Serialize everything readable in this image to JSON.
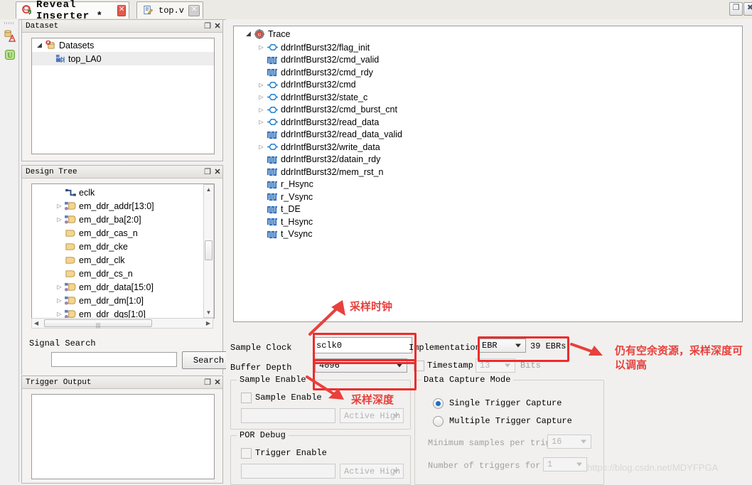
{
  "window": {
    "tabs": [
      {
        "label": "Reveal Inserter *",
        "icon": "reveal-icon",
        "closable": true,
        "active": true
      },
      {
        "label": "top.v",
        "icon": "file-edit-icon",
        "closable": true,
        "active": false
      }
    ],
    "controls": {
      "restore": "restore-icon",
      "close": "close-icon"
    }
  },
  "rail": {
    "icons": [
      "dataset-warning-icon",
      "trace-green-icon"
    ]
  },
  "dataset_panel": {
    "title": "Dataset",
    "buttons": {
      "float": "float-icon",
      "close": "close-icon"
    },
    "tree": [
      {
        "label": "Datasets",
        "depth": 0,
        "expanded": true,
        "icon": "datasets-icon",
        "selected": false
      },
      {
        "label": "top_LA0",
        "depth": 1,
        "expanded": null,
        "icon": "la-core-icon",
        "selected": true
      }
    ]
  },
  "design_tree_panel": {
    "title": "Design Tree",
    "buttons": {
      "float": "float-icon",
      "close": "close-icon"
    },
    "nodes": [
      {
        "label": "eclk",
        "expandable": false,
        "icon": "clock-icon"
      },
      {
        "label": "em_ddr_addr[13:0]",
        "expandable": true,
        "icon": "bus-icon"
      },
      {
        "label": "em_ddr_ba[2:0]",
        "expandable": true,
        "icon": "bus-icon"
      },
      {
        "label": "em_ddr_cas_n",
        "expandable": false,
        "icon": "wire-icon"
      },
      {
        "label": "em_ddr_cke",
        "expandable": false,
        "icon": "wire-icon"
      },
      {
        "label": "em_ddr_clk",
        "expandable": false,
        "icon": "wire-icon"
      },
      {
        "label": "em_ddr_cs_n",
        "expandable": false,
        "icon": "wire-icon"
      },
      {
        "label": "em_ddr_data[15:0]",
        "expandable": true,
        "icon": "bus-icon"
      },
      {
        "label": "em_ddr_dm[1:0]",
        "expandable": true,
        "icon": "bus-icon"
      },
      {
        "label": "em_ddr_dqs[1:0]",
        "expandable": true,
        "icon": "bus-icon"
      }
    ]
  },
  "signal_search": {
    "label": "Signal Search",
    "input_value": "",
    "input_placeholder": "",
    "button_label": "Search"
  },
  "trigger_output_panel": {
    "title": "Trigger Output",
    "buttons": {
      "float": "float-icon",
      "close": "close-icon"
    },
    "items": []
  },
  "trace_panel": {
    "root": {
      "label": "Trace",
      "expanded": true,
      "icon": "trace-icon"
    },
    "nodes": [
      {
        "label": "ddrIntfBurst32/flag_init",
        "expandable": true,
        "icon": "bus-signal-icon"
      },
      {
        "label": "ddrIntfBurst32/cmd_valid",
        "expandable": false,
        "icon": "waveform-icon"
      },
      {
        "label": "ddrIntfBurst32/cmd_rdy",
        "expandable": false,
        "icon": "waveform-icon"
      },
      {
        "label": "ddrIntfBurst32/cmd",
        "expandable": true,
        "icon": "bus-signal-icon"
      },
      {
        "label": "ddrIntfBurst32/state_c",
        "expandable": true,
        "icon": "bus-signal-icon"
      },
      {
        "label": "ddrIntfBurst32/cmd_burst_cnt",
        "expandable": true,
        "icon": "bus-signal-icon"
      },
      {
        "label": "ddrIntfBurst32/read_data",
        "expandable": true,
        "icon": "bus-signal-icon"
      },
      {
        "label": "ddrIntfBurst32/read_data_valid",
        "expandable": false,
        "icon": "waveform-icon"
      },
      {
        "label": "ddrIntfBurst32/write_data",
        "expandable": true,
        "icon": "bus-signal-icon"
      },
      {
        "label": "ddrIntfBurst32/datain_rdy",
        "expandable": false,
        "icon": "waveform-icon"
      },
      {
        "label": "ddrIntfBurst32/mem_rst_n",
        "expandable": false,
        "icon": "waveform-icon"
      },
      {
        "label": "r_Hsync",
        "expandable": false,
        "icon": "waveform-icon"
      },
      {
        "label": "r_Vsync",
        "expandable": false,
        "icon": "waveform-icon"
      },
      {
        "label": "t_DE",
        "expandable": false,
        "icon": "waveform-icon"
      },
      {
        "label": "t_Hsync",
        "expandable": false,
        "icon": "waveform-icon"
      },
      {
        "label": "t_Vsync",
        "expandable": false,
        "icon": "waveform-icon"
      }
    ]
  },
  "settings": {
    "sample_clock": {
      "label": "Sample Clock",
      "value": "sclk0"
    },
    "buffer_depth": {
      "label": "Buffer Depth",
      "value": "4096"
    },
    "implementation": {
      "label": "Implementation",
      "value": "EBR",
      "resource_text": "39 EBRs"
    },
    "timestamp": {
      "label": "Timestamp",
      "checked": false,
      "bits_value": "13",
      "bits_label": "Bits",
      "enabled": false
    },
    "sample_enable_group": {
      "caption": "Sample Enable",
      "checkbox_label": "Sample Enable",
      "checked": false,
      "signal_value": "",
      "polarity_value": "Active High"
    },
    "por_debug_group": {
      "caption": "POR Debug",
      "checkbox_label": "Trigger Enable",
      "checked": false,
      "signal_value": "",
      "polarity_value": "Active High"
    },
    "data_capture_group": {
      "caption": "Data Capture Mode",
      "options": [
        {
          "label": "Single Trigger Capture",
          "selected": true
        },
        {
          "label": "Multiple Trigger Capture",
          "selected": false
        }
      ],
      "min_samples": {
        "label": "Minimum samples per trigger",
        "value": "16"
      },
      "num_triggers": {
        "label": "Number of triggers for POR",
        "value": "1"
      }
    }
  },
  "annotations": {
    "sample_clock_note": "采样时钟",
    "buffer_depth_note": "采样深度",
    "resource_note": "仍有空余资源，采样深度可以调高",
    "accent_color": "#ee2b2b"
  },
  "watermark": {
    "text": "https://blog.csdn.net/MDYFPGA"
  }
}
